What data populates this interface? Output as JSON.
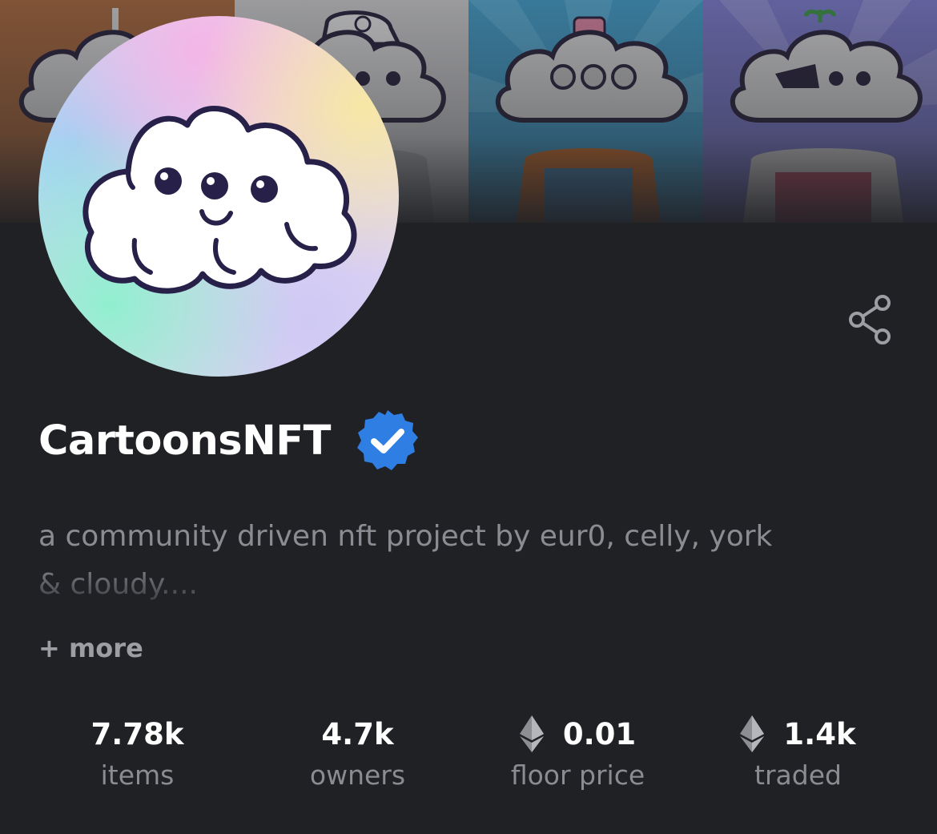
{
  "collection": {
    "name": "CartoonsNFT",
    "description_line1": "a community driven nft project by eur0, celly, york",
    "description_line2": "& cloudy....",
    "more_label": "+ more"
  },
  "stats": [
    {
      "value": "7.78k",
      "label": "items",
      "eth": false
    },
    {
      "value": "4.7k",
      "label": "owners",
      "eth": false
    },
    {
      "value": "0.01",
      "label": "floor price",
      "eth": true
    },
    {
      "value": "1.4k",
      "label": "traded",
      "eth": true
    }
  ],
  "icons": {
    "share": "share-icon",
    "verified": "verified-badge-icon",
    "eth": "ethereum-icon"
  },
  "colors": {
    "background": "#202125",
    "verified_badge": "#2f7ee3",
    "muted_text": "#8a8c92"
  }
}
